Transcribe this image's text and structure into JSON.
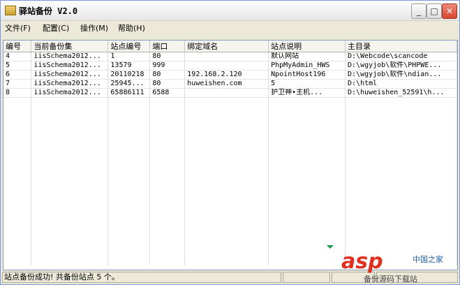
{
  "window": {
    "title": "驿站备份 V2.0"
  },
  "menu": [
    "文件(F)",
    "配置(C)",
    "操作(M)",
    "帮助(H)"
  ],
  "table": {
    "headers": [
      "编号",
      "当前备份集",
      "站点编号",
      "端口",
      "绑定域名",
      "站点说明",
      "主目录"
    ],
    "rows": [
      [
        "4",
        "iisSchema2012...",
        "1",
        "80",
        "",
        "默认网站",
        "D:\\Webcode\\scancode"
      ],
      [
        "5",
        "iisSchema2012...",
        "13579",
        "999",
        "",
        "PhpMyAdmin_HWS",
        "D:\\wgyjob\\软件\\PHPWE..."
      ],
      [
        "6",
        "iisSchema2012...",
        "20110218",
        "80",
        "192.168.2.120",
        "NpointHost196",
        "D:\\wgyjob\\软件\\ndian..."
      ],
      [
        "7",
        "iisSchema2012...",
        "25945...",
        "80",
        "huweishen.com",
        "5",
        "D:\\html"
      ],
      [
        "8",
        "iisSchema2012...",
        "65886111",
        "6588",
        "",
        "护卫神•主机...",
        "D:\\huweishen_52591\\h..."
      ]
    ]
  },
  "status": {
    "message": "站点备份成功! 共备份站点 5 个。"
  },
  "watermark": {
    "brand": "asp",
    "site": "中国之家",
    "sub": "备份源码下载站"
  },
  "icons": {
    "app": "app-icon",
    "minimize": "minimize-icon",
    "maximize": "maximize-icon",
    "close": "close-icon"
  }
}
